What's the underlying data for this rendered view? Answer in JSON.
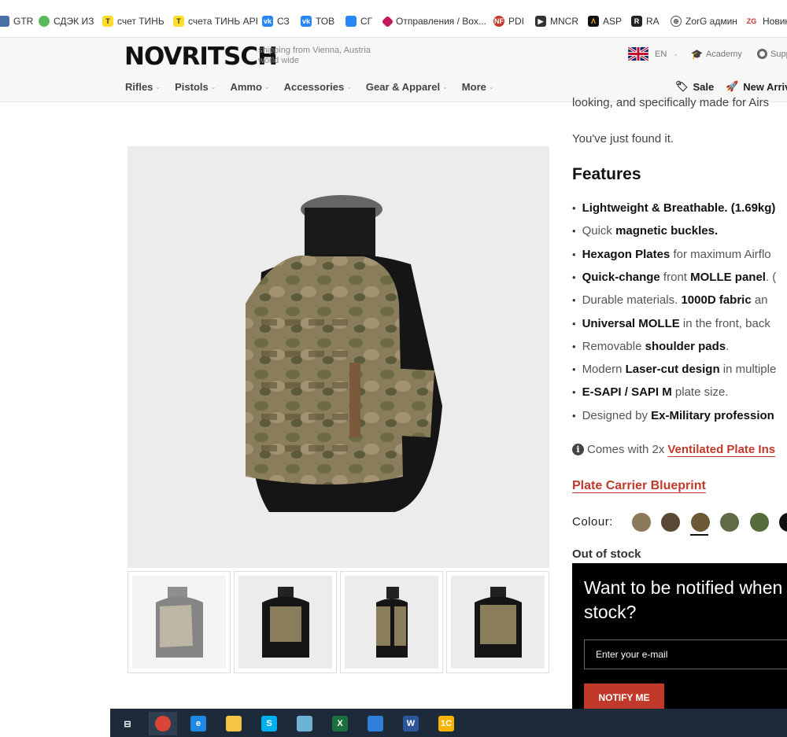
{
  "bookmarks": [
    {
      "label": "GTR",
      "icon": "gtr-icon",
      "color": "#4a6fa5"
    },
    {
      "label": "СДЭК ИЗ",
      "icon": "cdek-icon",
      "color": "#5cb85c"
    },
    {
      "label": "счет ТИНЬ",
      "icon": "tinkoff-icon",
      "color": "#ffdd2d"
    },
    {
      "label": "счета ТИНЬ API",
      "icon": "tinkoff-icon",
      "color": "#ffdd2d"
    },
    {
      "label": "СЗ",
      "icon": "vk-icon",
      "color": "#2787f5"
    },
    {
      "label": "ТОВ",
      "icon": "vk-icon",
      "color": "#2787f5"
    },
    {
      "label": "СГ",
      "icon": "chat-icon",
      "color": "#2787f5"
    },
    {
      "label": "Отправления / Box...",
      "icon": "box-icon",
      "color": "#c2185b"
    },
    {
      "label": "PDI",
      "icon": "pdi-icon",
      "color": "#c0392b"
    },
    {
      "label": "MNCR",
      "icon": "mncr-icon",
      "color": "#333333"
    },
    {
      "label": "ASP",
      "icon": "asp-icon",
      "color": "#111111"
    },
    {
      "label": "RA",
      "icon": "ra-icon",
      "color": "#222222"
    },
    {
      "label": "ZorG админ",
      "icon": "globe-icon",
      "color": "#555555"
    },
    {
      "label": "Новин",
      "icon": "zg-icon",
      "color": "#d32f2f"
    }
  ],
  "header": {
    "logo": "NOVRITSCH",
    "tagline_line1": "shipping from Vienna, Austria",
    "tagline_line2": "world wide",
    "language": "EN",
    "academy": "Academy",
    "support": "Supp",
    "nav": [
      "Rifles",
      "Pistols",
      "Ammo",
      "Accessories",
      "Gear & Apparel",
      "More"
    ],
    "sale": "Sale",
    "new_arrivals": "New Arriv"
  },
  "product": {
    "intro_cut": "looking, and specifically made for Airs",
    "found": "You've just found it.",
    "features_title": "Features",
    "features": [
      {
        "parts": [
          {
            "b": "Lightweight & Breathable. (1.69kg)"
          }
        ]
      },
      {
        "parts": [
          {
            "t": "Quick "
          },
          {
            "b": "magnetic buckles."
          }
        ]
      },
      {
        "parts": [
          {
            "b": "Hexagon Plates"
          },
          {
            "t": " for maximum Airflo"
          }
        ]
      },
      {
        "parts": [
          {
            "b": "Quick-change"
          },
          {
            "t": " front "
          },
          {
            "b": "MOLLE panel"
          },
          {
            "t": ". ("
          }
        ]
      },
      {
        "parts": [
          {
            "t": "Durable materials. "
          },
          {
            "b": "1000D fabric"
          },
          {
            "t": " an"
          }
        ]
      },
      {
        "parts": [
          {
            "b": "Universal MOLLE"
          },
          {
            "t": " in the front, back"
          }
        ]
      },
      {
        "parts": [
          {
            "t": "Removable "
          },
          {
            "b": "shoulder pads"
          },
          {
            "t": "."
          }
        ]
      },
      {
        "parts": [
          {
            "t": "Modern "
          },
          {
            "b": "Laser-cut design"
          },
          {
            "t": " in multiple"
          }
        ]
      },
      {
        "parts": [
          {
            "b": "E-SAPI / SAPI M"
          },
          {
            "t": " plate size."
          }
        ]
      },
      {
        "parts": [
          {
            "t": "Designed by "
          },
          {
            "b": "Ex-Military profession"
          }
        ]
      }
    ],
    "comes_with": "Comes with 2x",
    "comes_link": "Ventilated Plate Ins",
    "blueprint_link": "Plate Carrier Blueprint",
    "colour_label": "Colour:",
    "colours": [
      "#8b7b5c",
      "#5a4a35",
      "#6b5a35",
      "#5e6b45",
      "#556b3a",
      "#111111"
    ],
    "selected_colour_index": 2,
    "stock_status": "Out of stock"
  },
  "notify": {
    "title": "Want to be notified when stock?",
    "email_placeholder": "Enter your e-mail",
    "button": "NOTIFY ME"
  },
  "taskbar": [
    {
      "name": "task-view-icon",
      "label": "⊟",
      "color": "transparent"
    },
    {
      "name": "chrome-icon",
      "label": "",
      "color": "#db4437"
    },
    {
      "name": "edge-icon",
      "label": "e",
      "color": "#1e88e5"
    },
    {
      "name": "file-explorer-icon",
      "label": "",
      "color": "#f4c542"
    },
    {
      "name": "skype-icon",
      "label": "S",
      "color": "#00aff0"
    },
    {
      "name": "notes-icon",
      "label": "",
      "color": "#6fb3d2"
    },
    {
      "name": "excel-icon",
      "label": "X",
      "color": "#1d6f42"
    },
    {
      "name": "files-icon",
      "label": "",
      "color": "#2f7ed8"
    },
    {
      "name": "word-icon",
      "label": "W",
      "color": "#2b579a"
    },
    {
      "name": "1c-icon",
      "label": "1С",
      "color": "#f7b500"
    }
  ]
}
